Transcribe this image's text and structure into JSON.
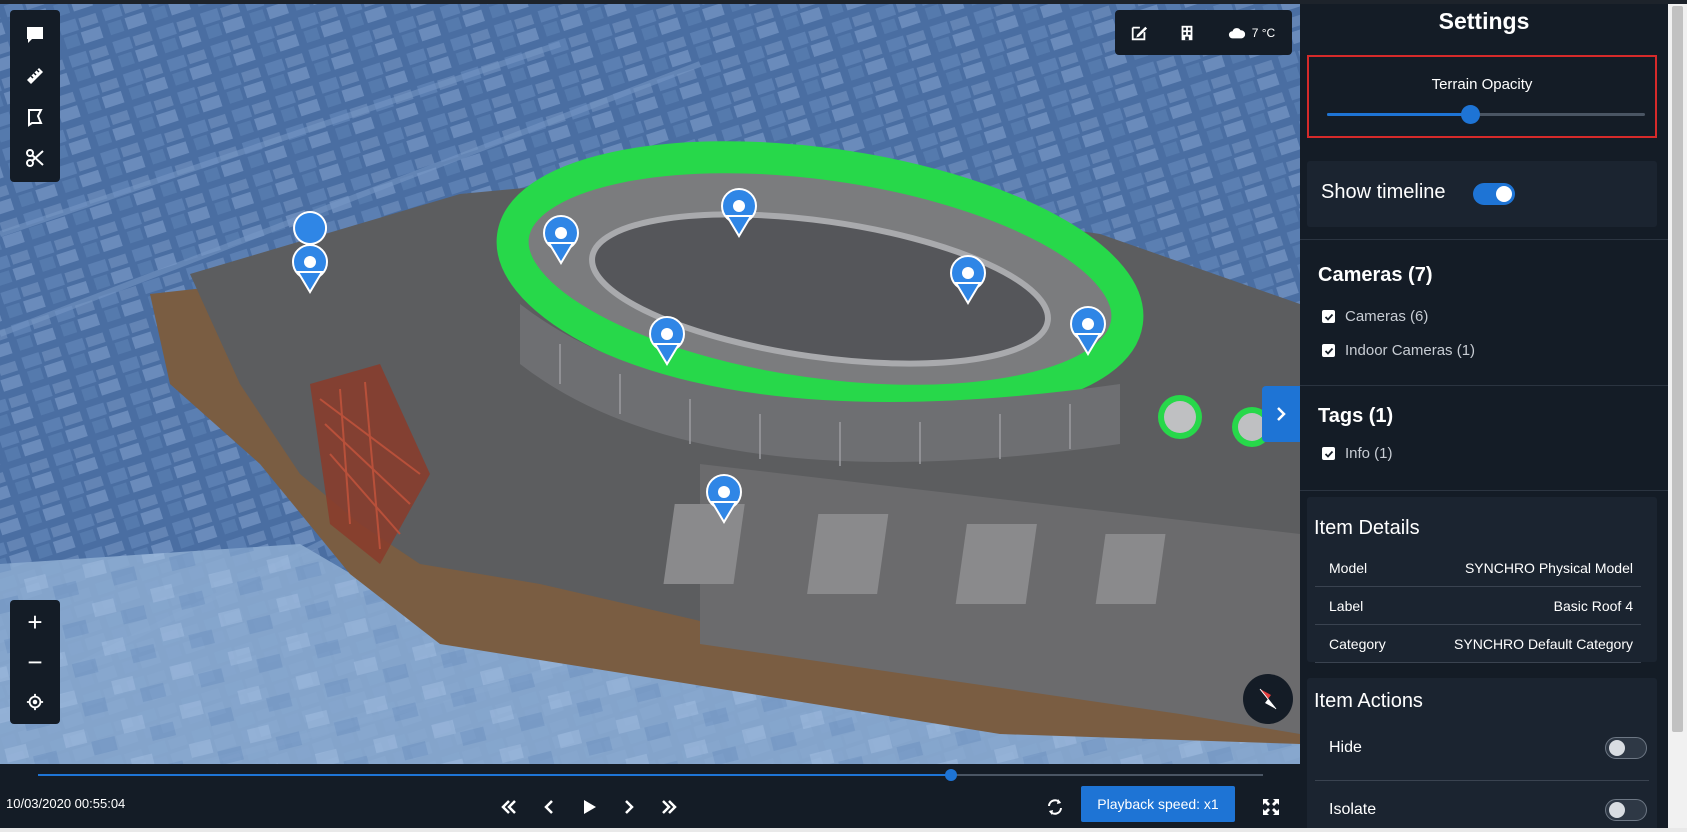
{
  "left_tools": [
    {
      "icon": "comment-icon",
      "name": "comment-tool"
    },
    {
      "icon": "ruler-icon",
      "name": "measure-tool"
    },
    {
      "icon": "flag-icon",
      "name": "area-tool"
    },
    {
      "icon": "scissors-icon",
      "name": "section-tool"
    }
  ],
  "top_tools": {
    "edit_icon": "edit-icon",
    "building_icon": "building-icon",
    "weather_icon": "cloud-icon",
    "weather_text": "7 °C"
  },
  "zoom": {
    "zoom_in_label": "+",
    "zoom_out_label": "−",
    "locate_icon": "crosshair-icon"
  },
  "timeline": {
    "datetime": "10/03/2020 00:55:04",
    "progress": 0.745,
    "playback_speed_label": "Playback speed: x1"
  },
  "settings": {
    "title": "Settings",
    "terrain_opacity_label": "Terrain Opacity",
    "terrain_opacity_value": 0.45,
    "show_timeline_label": "Show timeline",
    "show_timeline_on": true
  },
  "cameras": {
    "title": "Cameras (7)",
    "items": [
      {
        "label": "Cameras (6)",
        "checked": true
      },
      {
        "label": "Indoor Cameras (1)",
        "checked": true
      }
    ]
  },
  "tags": {
    "title": "Tags (1)",
    "items": [
      {
        "label": "Info (1)",
        "checked": true
      }
    ]
  },
  "item_details": {
    "title": "Item Details",
    "rows": [
      {
        "key": "Model",
        "value": "SYNCHRO Physical Model"
      },
      {
        "key": "Label",
        "value": "Basic Roof 4"
      },
      {
        "key": "Category",
        "value": "SYNCHRO Default Category"
      }
    ]
  },
  "item_actions": {
    "title": "Item Actions",
    "rows": [
      {
        "label": "Hide",
        "on": false
      },
      {
        "label": "Isolate",
        "on": false
      }
    ]
  },
  "colors": {
    "accent": "#1e74d5",
    "panel_bg": "#141c26",
    "card_bg": "#1b2430",
    "highlight_border": "#d62a2a",
    "roof_green": "#27d84a"
  }
}
